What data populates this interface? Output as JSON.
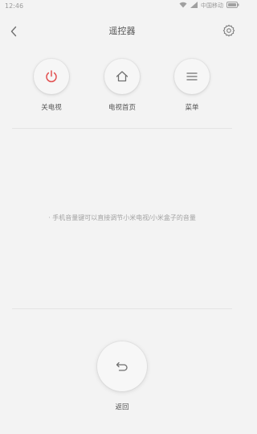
{
  "status_bar": {
    "time": "12:46",
    "carrier": "中国移动"
  },
  "header": {
    "title": "遥控器"
  },
  "controls": [
    {
      "label": "关电视",
      "icon": "power-icon",
      "color": "#e25050"
    },
    {
      "label": "电视首页",
      "icon": "home-icon"
    },
    {
      "label": "菜单",
      "icon": "menu-icon"
    }
  ],
  "hint": "· 手机音量键可以直接调节小米电视/小米盒子的音量",
  "return_button": {
    "label": "返回",
    "icon": "return-arrow-icon"
  }
}
